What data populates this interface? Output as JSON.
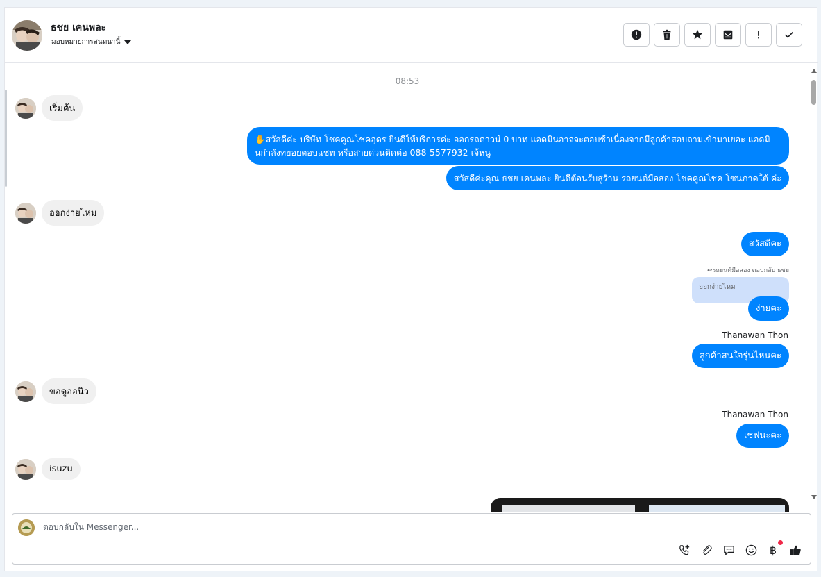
{
  "header": {
    "contact_name": "ธชย เคนพละ",
    "assign_label": "มอบหมายการสนทนานี้"
  },
  "thread": {
    "timestamp": "08:53",
    "messages": [
      {
        "dir": "in",
        "text": "เริ่มต้น"
      },
      {
        "dir": "out",
        "text": "✋สวัสดีค่ะ บริษัท โชคคูณโชคอุดร ยินดีให้บริการค่ะ ออกรถดาวน์ 0 บาท แอดมินอาจจะตอบช้าเนื่องจากมีลูกค้าสอบถามเข้ามาเยอะ แอดมินกำลังทยอยตอบแชท หรือสายด่วนติดต่อ 088-5577932 เจ้หนู"
      },
      {
        "dir": "out",
        "text": "สวัสดีค่ะคุณ ธชย เคนพละ ยินดีต้อนรับสู่ร้าน รถยนต์มือสอง โชคคูณโชค โซนภาคใต้ ค่ะ"
      },
      {
        "dir": "in",
        "text": "ออกง่ายไหม"
      },
      {
        "dir": "out",
        "text": "สวัสดีคะ"
      },
      {
        "dir": "out",
        "reply_label": "↩รถยนต์มือสอง ตอบกลับ ธชย",
        "quoted": "ออกง่ายไหม",
        "text": "ง่ายคะ"
      },
      {
        "dir": "out",
        "sender": "Thanawan Thon",
        "text": "ลูกค้าสนใจรุ่นไหนคะ"
      },
      {
        "dir": "in",
        "text": "ขอดูออนิว"
      },
      {
        "dir": "out",
        "sender": "Thanawan Thon",
        "text": "เชฟนะคะ"
      },
      {
        "dir": "in",
        "text": "isuzu"
      }
    ]
  },
  "composer": {
    "placeholder": "ตอบกลับใน Messenger..."
  },
  "colors": {
    "outgoing": "#0084ff",
    "incoming": "#f0f0f0",
    "notification_dot": "#f02849"
  }
}
